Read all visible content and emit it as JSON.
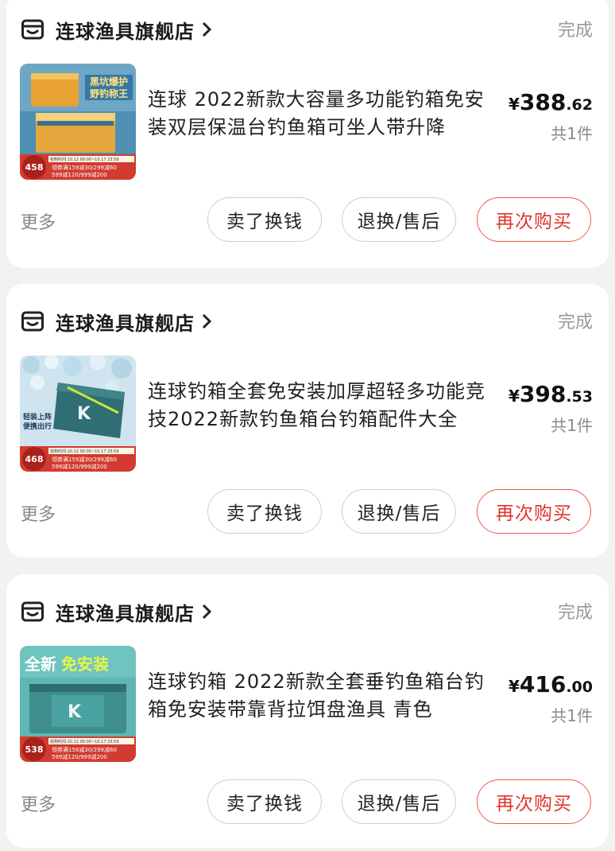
{
  "orders": [
    {
      "shop": "连球渔具旗舰店",
      "status": "完成",
      "title": "连球 2022新款大容量多功能钓箱免安装双层保温台钓鱼箱可坐人带升降",
      "price_yen": "¥",
      "price_int": "388",
      "price_dec": ".62",
      "qty": "共1件",
      "more": "更多",
      "btn_sell": "卖了换钱",
      "btn_after": "退换/售后",
      "btn_rebuy": "再次购买",
      "thumb": {
        "headline1": "黑坑爆护",
        "headline2": "野钓称王",
        "badge": "458",
        "promo1": "领券满159减30/299减60",
        "promo2": "599减120/999减200",
        "time": "抢购时间:10.12 00:00~10.17 23:59"
      }
    },
    {
      "shop": "连球渔具旗舰店",
      "status": "完成",
      "title": "连球钓箱全套免安装加厚超轻多功能竞技2022新款钓鱼箱台钓箱配件大全",
      "price_yen": "¥",
      "price_int": "398",
      "price_dec": ".53",
      "qty": "共1件",
      "more": "更多",
      "btn_sell": "卖了换钱",
      "btn_after": "退换/售后",
      "btn_rebuy": "再次购买",
      "thumb": {
        "headline1": "轻装上阵",
        "headline2": "便携出行",
        "badge": "468",
        "promo1": "领券满159减30/299减60",
        "promo2": "599减120/999减200",
        "time": "抢购时间:10.12 00:00~10.17 23:59"
      }
    },
    {
      "shop": "连球渔具旗舰店",
      "status": "完成",
      "title": "连球钓箱 2022新款全套垂钓鱼箱台钓箱免安装带靠背拉饵盘渔具 青色",
      "price_yen": "¥",
      "price_int": "416",
      "price_dec": ".00",
      "qty": "共1件",
      "more": "更多",
      "btn_sell": "卖了换钱",
      "btn_after": "退换/售后",
      "btn_rebuy": "再次购买",
      "thumb": {
        "headline1": "全新",
        "headline2": "免安装",
        "badge": "538",
        "promo1": "领券满159减30/299减60",
        "promo2": "599减120/999减200",
        "time": "抢购时间:10.12 00:00~10.17 23:59"
      }
    }
  ],
  "colors": {
    "accent": "#e0342a",
    "muted": "#9a9a9a",
    "background": "#f2f2f2"
  },
  "icons": {
    "shop": "store-icon",
    "chevron": "chevron-right-icon"
  }
}
